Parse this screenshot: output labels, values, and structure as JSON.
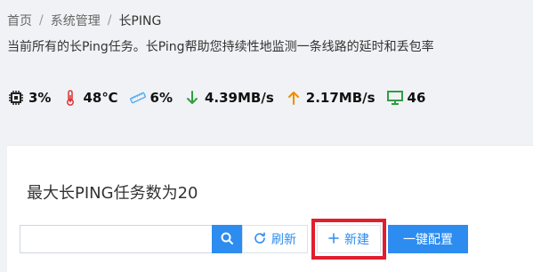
{
  "breadcrumb": {
    "items": [
      "首页",
      "系统管理",
      "长PING"
    ],
    "separator": "/"
  },
  "description": "当前所有的长Ping任务。长Ping帮助您持续性地监测一条线路的延时和丢包率",
  "stats": {
    "cpu": {
      "icon": "chip-icon",
      "value": "3%"
    },
    "temperature": {
      "icon": "thermometer-icon",
      "value": "48℃"
    },
    "memory": {
      "icon": "memory-icon",
      "value": "6%"
    },
    "download": {
      "icon": "arrow-down-icon",
      "value": "4.39MB/s"
    },
    "upload": {
      "icon": "arrow-up-icon",
      "value": "2.17MB/s"
    },
    "devices": {
      "icon": "monitor-icon",
      "value": "46"
    }
  },
  "card": {
    "title": "最大长PING任务数为20"
  },
  "toolbar": {
    "search": {
      "value": "",
      "placeholder": ""
    },
    "refresh_label": "刷新",
    "new_label": "新建",
    "config_label": "一键配置"
  },
  "colors": {
    "primary": "#2d8cf0",
    "highlight": "#e11d2e",
    "download_arrow": "#2f9e44",
    "upload_arrow": "#f08c00",
    "thermometer": "#e03131",
    "monitor": "#2f9e44"
  }
}
